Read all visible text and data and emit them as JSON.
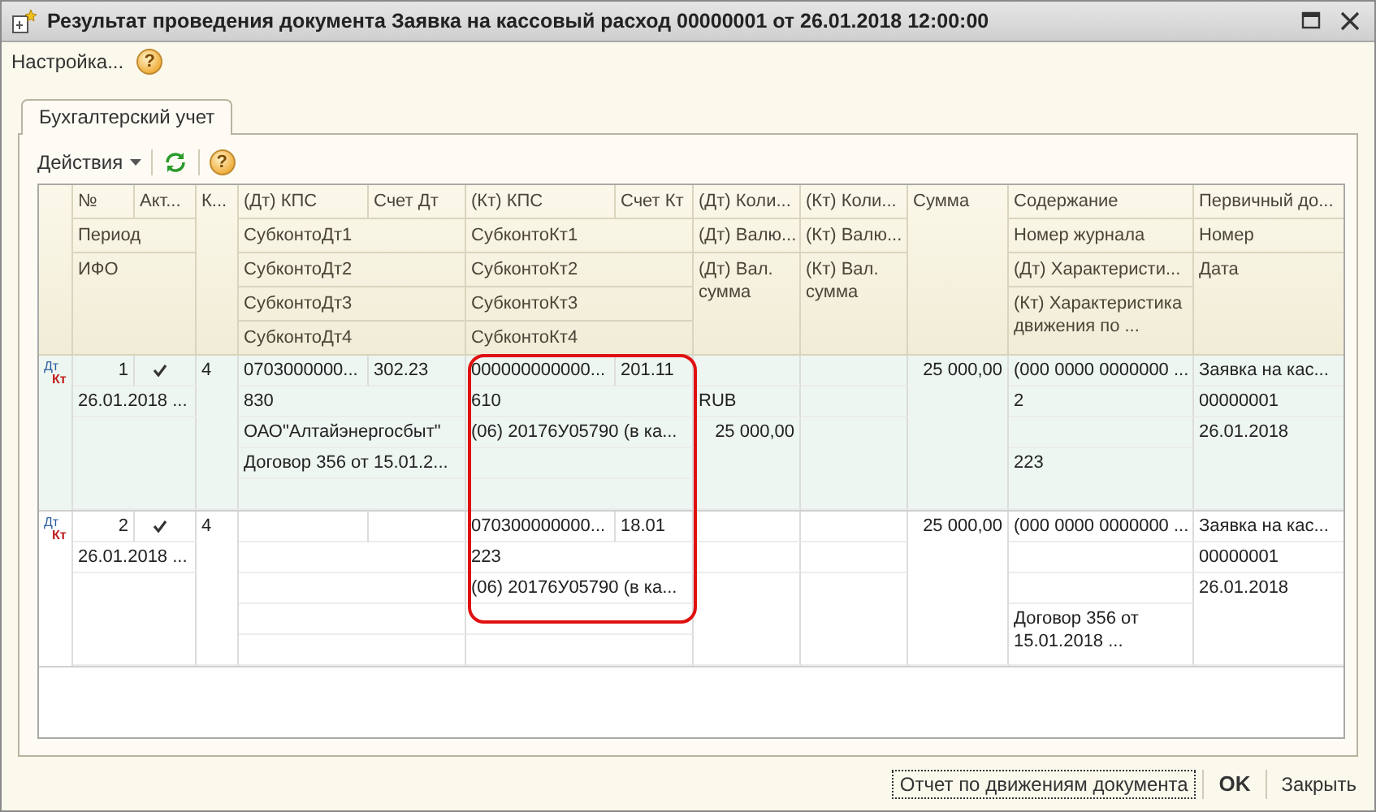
{
  "window": {
    "title": "Результат проведения документа Заявка на кассовый расход 00000001 от 26.01.2018 12:00:00"
  },
  "toolbar": {
    "settings": "Настройка...",
    "help": "?"
  },
  "tabs": [
    {
      "label": "Бухгалтерский учет",
      "selected": true
    }
  ],
  "table_toolbar": {
    "actions": "Действия",
    "help": "?"
  },
  "table": {
    "columns": [
      "№",
      "Акт...",
      "К...",
      "(Дт) КПС",
      "Счет Дт",
      "(Кт) КПС",
      "Счет Кт",
      "(Дт) Коли...",
      "(Кт) Коли...",
      "Сумма",
      "Содержание",
      "Первичный до...",
      "Период",
      "СубконтоДт1",
      "СубконтоКт1",
      "(Дт) Валю...",
      "(Кт) Валю...",
      "Номер журнала",
      "Номер",
      "ИФО",
      "СубконтоДт2",
      "СубконтоКт2",
      "(Дт) Вал. сумма",
      "(Кт) Вал. сумма",
      "(Дт) Характеристи...",
      "Дата",
      "СубконтоДт3",
      "СубконтоКт3",
      "СубконтоДт4",
      "СубконтоКт4",
      "(Кт) Характеристика движения по ..."
    ],
    "rows": [
      {
        "selected": true,
        "debit_mark": "Дт",
        "credit_mark": "Кт",
        "number": "1",
        "active": true,
        "period": "26.01.2018 ...",
        "k": "4",
        "dt_kps": "0703000000...",
        "dt_account": "302.23",
        "dt_subconto": [
          "830",
          "ОАО\"Алтайэнергосбыт\"",
          "Договор 356 от 15.01.2..."
        ],
        "kt_kps": "000000000000...",
        "kt_account": "201.11",
        "kt_subconto": [
          "610",
          "(06) 20176У05790 (в ка..."
        ],
        "dt_currency": "RUB",
        "dt_amount": "25 000,00",
        "sum": "25 000,00",
        "content": "(000 0000 0000000 ...",
        "journal": "2",
        "kt_char": "223",
        "doc": "Заявка на кас...",
        "doc_number": "00000001",
        "doc_date": "26.01.2018"
      },
      {
        "selected": false,
        "debit_mark": "Дт",
        "credit_mark": "Кт",
        "number": "2",
        "active": true,
        "period": "26.01.2018 ...",
        "k": "4",
        "kt_kps": "070300000000...",
        "kt_account": "18.01",
        "kt_subconto": [
          "223",
          "(06) 20176У05790 (в ка..."
        ],
        "sum": "25 000,00",
        "content": "(000 0000 0000000 ...",
        "kt_char": "Договор 356 от 15.01.2018 ...",
        "doc": "Заявка на кас...",
        "doc_number": "00000001",
        "doc_date": "26.01.2018"
      }
    ]
  },
  "footer": {
    "buttons": [
      {
        "label": "Отчет по движениям документа",
        "focused": true,
        "default": false
      },
      {
        "label": "OK",
        "focused": false,
        "default": true
      },
      {
        "label": "Закрыть",
        "focused": false,
        "default": false
      }
    ]
  }
}
